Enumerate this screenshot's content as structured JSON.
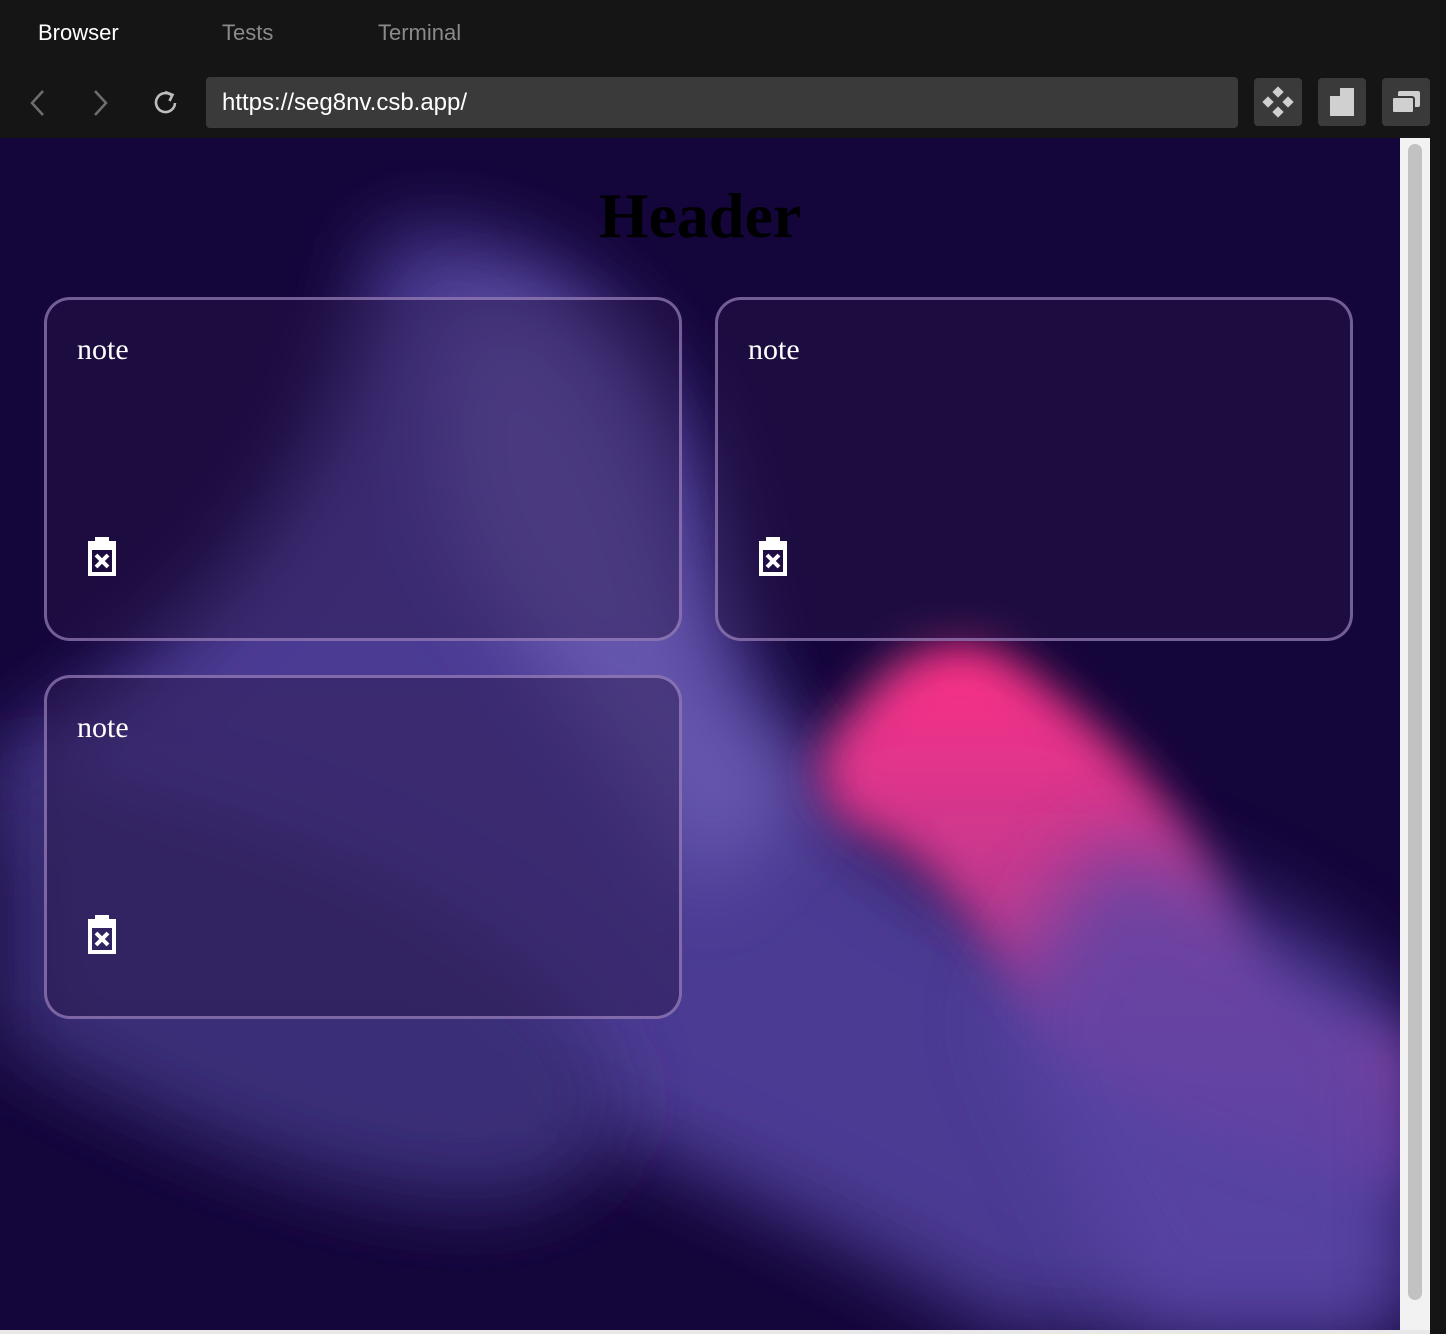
{
  "tabs": [
    {
      "label": "Browser",
      "active": true
    },
    {
      "label": "Tests",
      "active": false
    },
    {
      "label": "Terminal",
      "active": false
    }
  ],
  "toolbar": {
    "back_icon": "chevron-left-icon",
    "forward_icon": "chevron-right-icon",
    "reload_icon": "reload-icon",
    "url": "https://seg8nv.csb.app/",
    "tool_icons": [
      "diamond-grid-icon",
      "split-view-icon",
      "new-window-icon"
    ]
  },
  "page": {
    "header": "Header",
    "notes": [
      {
        "text": "note",
        "delete_icon": "trash-icon"
      },
      {
        "text": "note",
        "delete_icon": "trash-icon"
      },
      {
        "text": "note",
        "delete_icon": "trash-icon"
      }
    ]
  },
  "colors": {
    "chrome_bg": "#151515",
    "url_bg": "#3a3a3a",
    "page_bg_dark": "#14053a",
    "wave_purple": "#5a4aa6",
    "wave_pink": "#e8307e",
    "card_border": "#b9a0dc"
  }
}
